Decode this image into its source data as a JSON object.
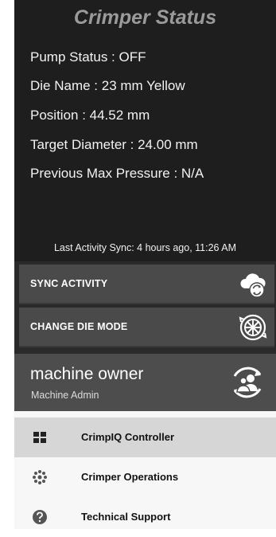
{
  "status": {
    "title": "Crimper Status",
    "pump_status": "Pump Status : OFF",
    "die_name": "Die Name : 23 mm Yellow",
    "position": "Position : 44.52 mm",
    "target_diameter": "Target Diameter : 24.00 mm",
    "previous_max_pressure": "Previous Max Pressure : N/A",
    "last_sync": "Last Activity Sync: 4 hours ago, 11:26 AM"
  },
  "actions": [
    {
      "label": "SYNC ACTIVITY",
      "icon": "cloud-sync-icon"
    },
    {
      "label": "CHANGE DIE MODE",
      "icon": "die-wheel-icon"
    }
  ],
  "profile": {
    "name": "machine owner",
    "role": "Machine Admin",
    "icon": "switch-user-icon"
  },
  "menu": [
    {
      "label": "CrimpIQ Controller",
      "icon": "grid-icon",
      "active": true
    },
    {
      "label": "Crimper Operations",
      "icon": "gear-dots-icon",
      "active": false
    },
    {
      "label": "Technical Support",
      "icon": "help-icon",
      "active": false
    }
  ],
  "colors": {
    "panel": "#1e1e1e",
    "button": "#4a4a4a",
    "profile": "#4d4d4d",
    "menu_bg": "#f7f7f7",
    "menu_active": "#d6d6d6"
  }
}
